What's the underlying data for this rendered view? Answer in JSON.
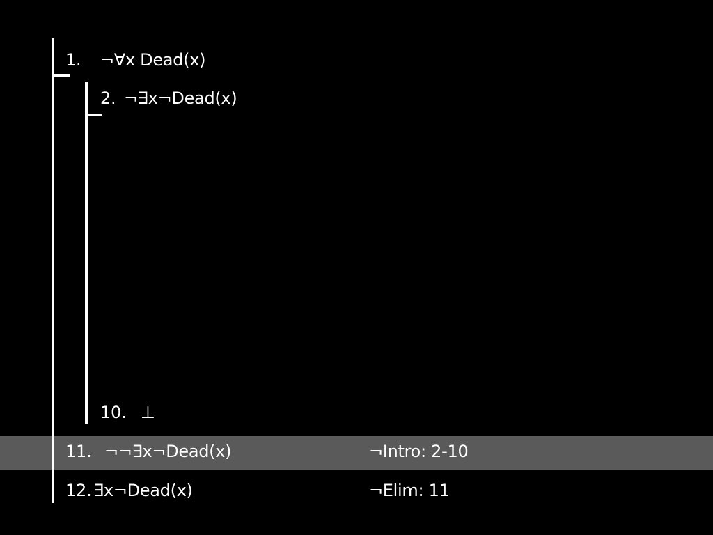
{
  "proof": {
    "lines": [
      {
        "num": "1.",
        "formula": "¬∀x Dead(x)",
        "justification": ""
      },
      {
        "num": "2.",
        "formula": "¬∃x¬Dead(x)",
        "justification": ""
      },
      {
        "num": "10.",
        "formula": "⊥",
        "justification": ""
      },
      {
        "num": "11.",
        "formula": "¬¬∃x¬Dead(x)",
        "justification": "¬Intro: 2-10"
      },
      {
        "num": "12.",
        "formula": "∃x¬Dead(x)",
        "justification": "¬Elim: 11"
      }
    ],
    "highlight_color": "#5a5a5a"
  }
}
